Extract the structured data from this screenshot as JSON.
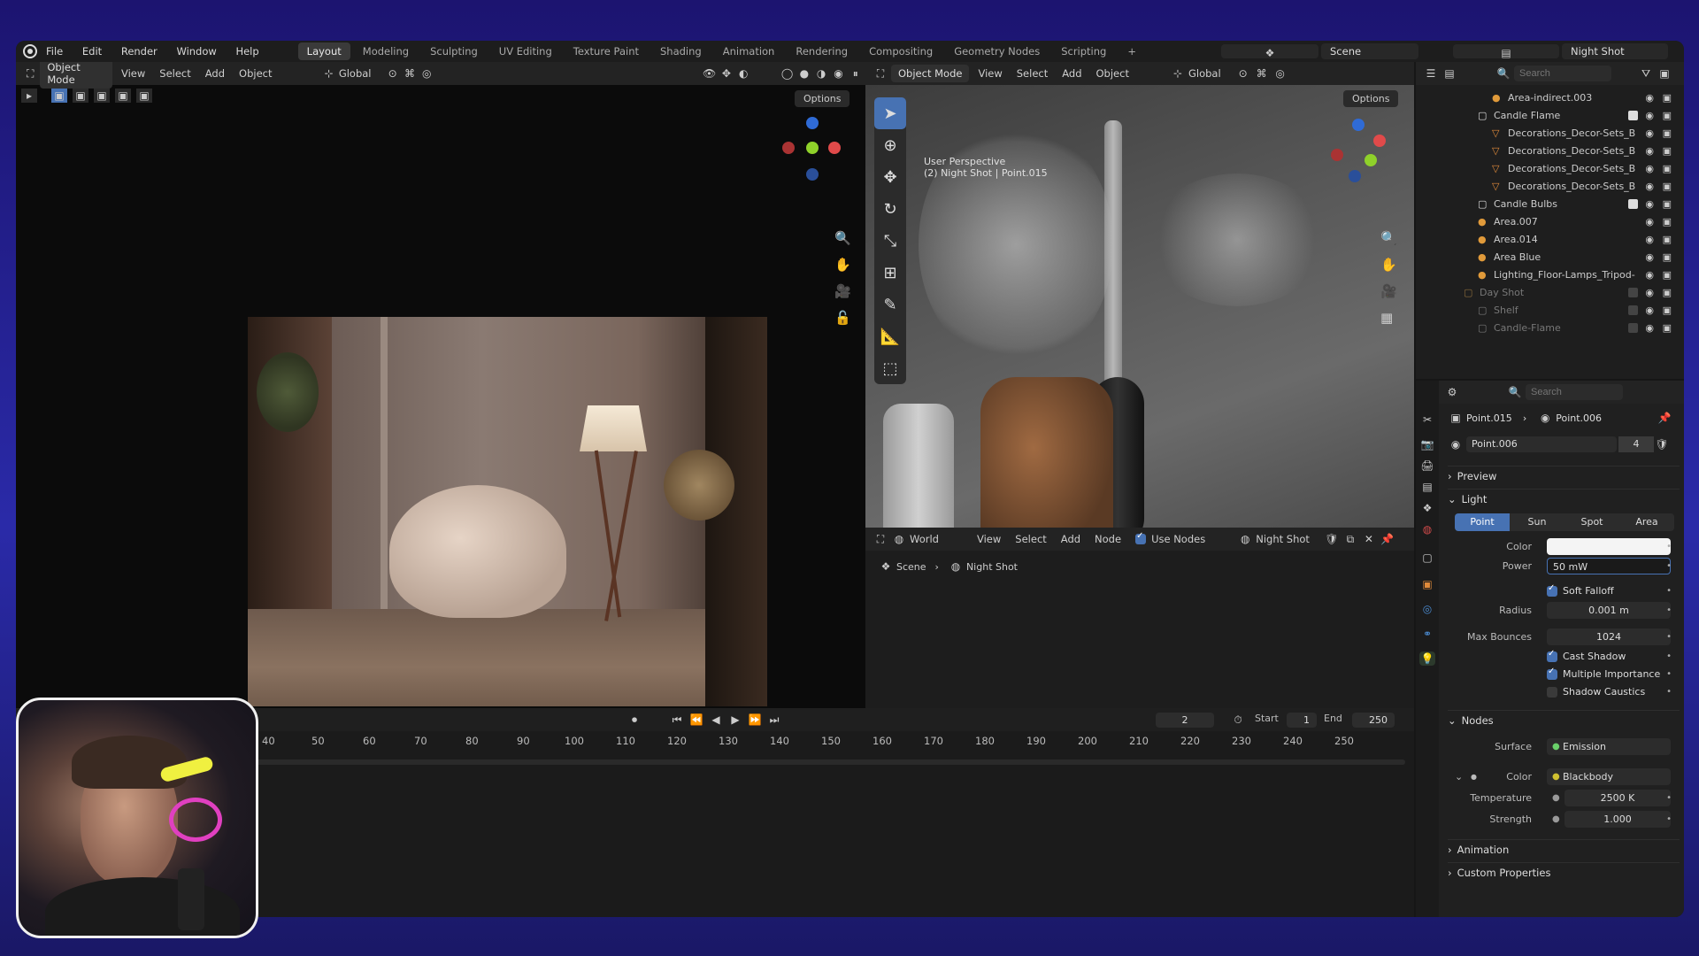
{
  "topbar": {
    "menu": [
      "File",
      "Edit",
      "Render",
      "Window",
      "Help"
    ],
    "workspaces": [
      "Layout",
      "Modeling",
      "Sculpting",
      "UV Editing",
      "Texture Paint",
      "Shading",
      "Animation",
      "Rendering",
      "Compositing",
      "Geometry Nodes",
      "Scripting"
    ],
    "active_workspace": "Layout",
    "scene": "Scene",
    "view_layer": "Night Shot"
  },
  "left_viewport": {
    "mode": "Object Mode",
    "menu": [
      "View",
      "Select",
      "Add",
      "Object"
    ],
    "orientation": "Global",
    "options": "Options"
  },
  "right_viewport": {
    "mode": "Object Mode",
    "menu": [
      "View",
      "Select",
      "Add",
      "Object"
    ],
    "orientation": "Global",
    "options": "Options",
    "overlay_line1": "User Perspective",
    "overlay_line2": "(2) Night Shot | Point.015"
  },
  "node_editor": {
    "world_type": "World",
    "menu": [
      "View",
      "Select",
      "Add",
      "Node"
    ],
    "use_nodes": "Use Nodes",
    "world_name": "Night Shot",
    "breadcrumb_scene": "Scene",
    "breadcrumb_world": "Night Shot"
  },
  "timeline": {
    "current_frame": "2",
    "start_label": "Start",
    "start": "1",
    "end_label": "End",
    "end": "250",
    "ticks": [
      "40",
      "50",
      "60",
      "70",
      "80",
      "90",
      "100",
      "110",
      "120",
      "130",
      "140",
      "150",
      "160",
      "170",
      "180",
      "190",
      "200",
      "210",
      "220",
      "230",
      "240",
      "250"
    ]
  },
  "outliner": {
    "search_placeholder": "Search",
    "rows": [
      {
        "name": "Area-indirect.003",
        "dim": false
      },
      {
        "name": "Candle Flame",
        "dim": false
      },
      {
        "name": "Decorations_Decor-Sets_B",
        "dim": false
      },
      {
        "name": "Decorations_Decor-Sets_B",
        "dim": false
      },
      {
        "name": "Decorations_Decor-Sets_B",
        "dim": false
      },
      {
        "name": "Decorations_Decor-Sets_B",
        "dim": false
      },
      {
        "name": "Candle Bulbs",
        "dim": false
      },
      {
        "name": "Area.007",
        "dim": false
      },
      {
        "name": "Area.014",
        "dim": false
      },
      {
        "name": "Area Blue",
        "dim": false
      },
      {
        "name": "Lighting_Floor-Lamps_Tripod-",
        "dim": false
      },
      {
        "name": "Day Shot",
        "dim": true
      },
      {
        "name": "Shelf",
        "dim": true
      },
      {
        "name": "Candle-Flame",
        "dim": true
      }
    ]
  },
  "properties": {
    "search_placeholder": "Search",
    "crumb_object": "Point.015",
    "crumb_data": "Point.006",
    "datablock": "Point.006",
    "users": "4",
    "preview": "Preview",
    "light": "Light",
    "light_types": [
      "Point",
      "Sun",
      "Spot",
      "Area"
    ],
    "active_light_type": "Point",
    "color_label": "Color",
    "power_label": "Power",
    "power": "50 mW",
    "soft_falloff": "Soft Falloff",
    "radius_label": "Radius",
    "radius": "0.001 m",
    "max_bounces_label": "Max Bounces",
    "max_bounces": "1024",
    "cast_shadow": "Cast Shadow",
    "multiple_importance": "Multiple Importance",
    "shadow_caustics": "Shadow Caustics",
    "nodes": "Nodes",
    "surface_label": "Surface",
    "surface": "Emission",
    "node_color_label": "Color",
    "node_color": "Blackbody",
    "temperature_label": "Temperature",
    "temperature": "2500 K",
    "strength_label": "Strength",
    "strength": "1.000",
    "animation": "Animation",
    "custom_properties": "Custom Properties"
  }
}
